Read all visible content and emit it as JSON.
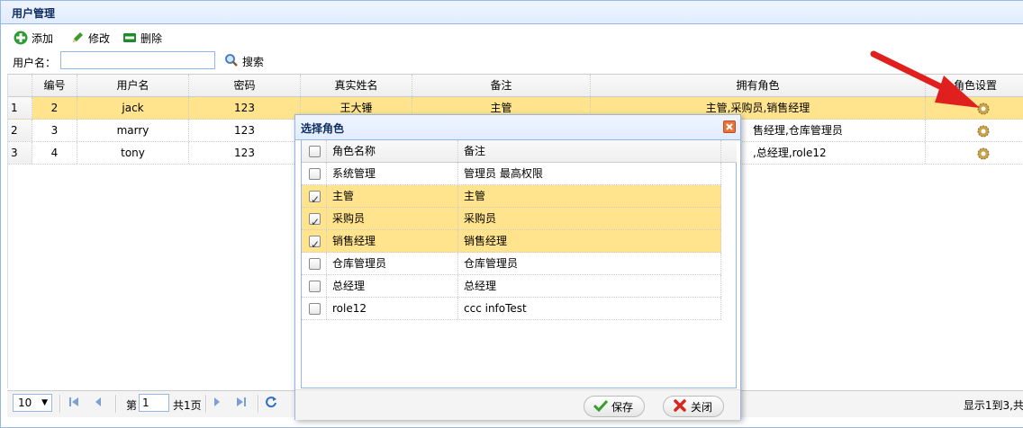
{
  "panel": {
    "title": "用户管理"
  },
  "toolbar": {
    "add": "添加",
    "edit": "修改",
    "delete": "删除"
  },
  "search": {
    "label": "用户名：",
    "value": "",
    "button": "搜索"
  },
  "grid": {
    "columns": [
      "编号",
      "用户名",
      "密码",
      "真实姓名",
      "备注",
      "拥有角色",
      "角色设置"
    ],
    "rows": [
      {
        "rownum": "1",
        "id": "2",
        "username": "jack",
        "password": "123",
        "realname": "王大锤",
        "note": "主管",
        "roles": "主管,采购员,销售经理"
      },
      {
        "rownum": "2",
        "id": "3",
        "username": "marry",
        "password": "123",
        "realname": "",
        "note": "",
        "roles": "售经理,仓库管理员"
      },
      {
        "rownum": "3",
        "id": "4",
        "username": "tony",
        "password": "123",
        "realname": "",
        "note": "",
        "roles": ",总经理,role12"
      }
    ]
  },
  "pager": {
    "page_size": "10",
    "page_label": "第",
    "page": "1",
    "total_pages": "共1页",
    "info": "显示1到3,共"
  },
  "dialog": {
    "title": "选择角色",
    "columns": [
      "角色名称",
      "备注"
    ],
    "rows": [
      {
        "name": "系统管理",
        "note": "管理员 最高权限",
        "checked": false
      },
      {
        "name": "主管",
        "note": "主管",
        "checked": true
      },
      {
        "name": "采购员",
        "note": "采购员",
        "checked": true
      },
      {
        "name": "销售经理",
        "note": "销售经理",
        "checked": true
      },
      {
        "name": "仓库管理员",
        "note": "仓库管理员",
        "checked": false
      },
      {
        "name": "总经理",
        "note": "总经理",
        "checked": false
      },
      {
        "name": "role12",
        "note": "ccc infoTest",
        "checked": false
      }
    ],
    "save": "保存",
    "close": "关闭"
  },
  "colors": {
    "selected_row": "#ffe48d",
    "border": "#95b8e7",
    "arrow": "#e0201f"
  }
}
